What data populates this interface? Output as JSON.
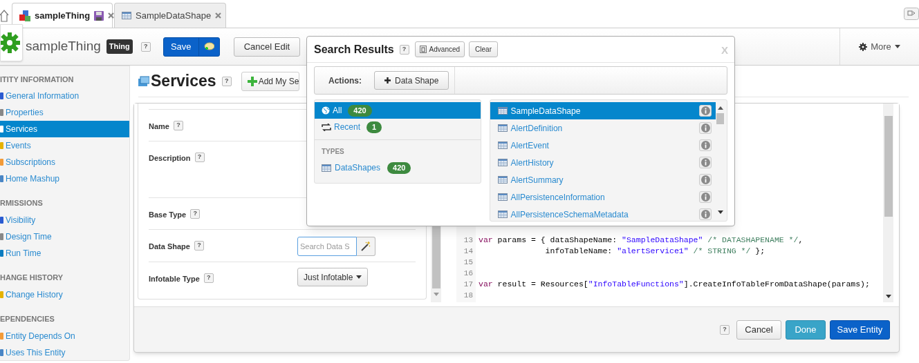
{
  "tabs": [
    {
      "label": "sampleThing",
      "selected": true
    },
    {
      "label": "SampleDataShape",
      "selected": false
    }
  ],
  "entity": {
    "name": "sampleThing",
    "type_badge": "Thing",
    "help": "?",
    "save": "Save",
    "cancel": "Cancel Edit",
    "more": "More"
  },
  "sidebar": [
    {
      "heading": "ITITY INFORMATION",
      "items": [
        {
          "label": "General Information",
          "selected": false
        },
        {
          "label": "Properties",
          "selected": false
        },
        {
          "label": "Services",
          "selected": true
        },
        {
          "label": "Events",
          "selected": false
        },
        {
          "label": "Subscriptions",
          "selected": false
        },
        {
          "label": "Home Mashup",
          "selected": false
        }
      ]
    },
    {
      "heading": "RMISSIONS",
      "items": [
        {
          "label": "Visibility",
          "selected": false
        },
        {
          "label": "Design Time",
          "selected": false
        },
        {
          "label": "Run Time",
          "selected": false
        }
      ]
    },
    {
      "heading": "HANGE HISTORY",
      "items": [
        {
          "label": "Change History",
          "selected": false
        }
      ]
    },
    {
      "heading": "EPENDENCIES",
      "items": [
        {
          "label": "Entity Depends On",
          "selected": false
        },
        {
          "label": "Uses This Entity",
          "selected": false
        }
      ]
    }
  ],
  "section": {
    "title": "Services",
    "help": "?",
    "add_button": "Add My Se"
  },
  "form": {
    "fields": [
      {
        "label": "Name",
        "help": "?",
        "kind": "text"
      },
      {
        "label": "Description",
        "help": "?",
        "kind": "tall"
      },
      {
        "label": "Base Type",
        "help": "?",
        "kind": "text"
      },
      {
        "label": "Data Shape",
        "help": "?",
        "kind": "search",
        "placeholder": "Search Data S"
      },
      {
        "label": "Infotable Type",
        "help": "?",
        "kind": "dropdown",
        "value": "Just Infotable"
      }
    ]
  },
  "code": {
    "lines": [
      {
        "number": "13",
        "tokens": [
          {
            "kind": "keyword",
            "text": "var"
          },
          {
            "kind": "plain",
            "text": " params = { dataShapeName: "
          },
          {
            "kind": "string",
            "text": "\"SampleDataShape\""
          },
          {
            "kind": "comment",
            "text": " /* DATASHAPENAME */"
          },
          {
            "kind": "plain",
            "text": ","
          }
        ]
      },
      {
        "number": "14",
        "tokens": [
          {
            "kind": "plain",
            "text": "              infoTableName: "
          },
          {
            "kind": "string",
            "text": "\"alertService1\""
          },
          {
            "kind": "comment",
            "text": " /* STRING */"
          },
          {
            "kind": "plain",
            "text": " };"
          }
        ]
      },
      {
        "number": "15"
      },
      {
        "number": "16"
      },
      {
        "number": "17",
        "tokens": [
          {
            "kind": "keyword",
            "text": "var"
          },
          {
            "kind": "plain",
            "text": " result = Resources["
          },
          {
            "kind": "string",
            "text": "\"InfoTableFunctions\""
          },
          {
            "kind": "plain",
            "text": "].CreateInfoTableFromDataShape(params);"
          }
        ]
      },
      {
        "number": "18"
      }
    ]
  },
  "footer": {
    "help": "?",
    "cancel": "Cancel",
    "done": "Done",
    "save": "Save Entity"
  },
  "search_popup": {
    "title": "Search Results",
    "help": "?",
    "advanced": "Advanced",
    "clear": "Clear",
    "close": "X",
    "actions_label": "Actions:",
    "action_button": "Data Shape",
    "filters": [
      {
        "label": "All",
        "count": "420",
        "selected": true
      },
      {
        "label": "Recent",
        "count": "1",
        "selected": false
      }
    ],
    "types_heading": "TYPES",
    "types": [
      {
        "label": "DataShapes",
        "count": "420"
      }
    ],
    "results": [
      {
        "label": "SampleDataShape",
        "selected": true
      },
      {
        "label": "AlertDefinition",
        "selected": false
      },
      {
        "label": "AlertEvent",
        "selected": false
      },
      {
        "label": "AlertHistory",
        "selected": false
      },
      {
        "label": "AlertSummary",
        "selected": false
      },
      {
        "label": "AllPersistenceInformation",
        "selected": false
      },
      {
        "label": "AllPersistenceSchemaMetadata",
        "selected": false
      }
    ]
  }
}
